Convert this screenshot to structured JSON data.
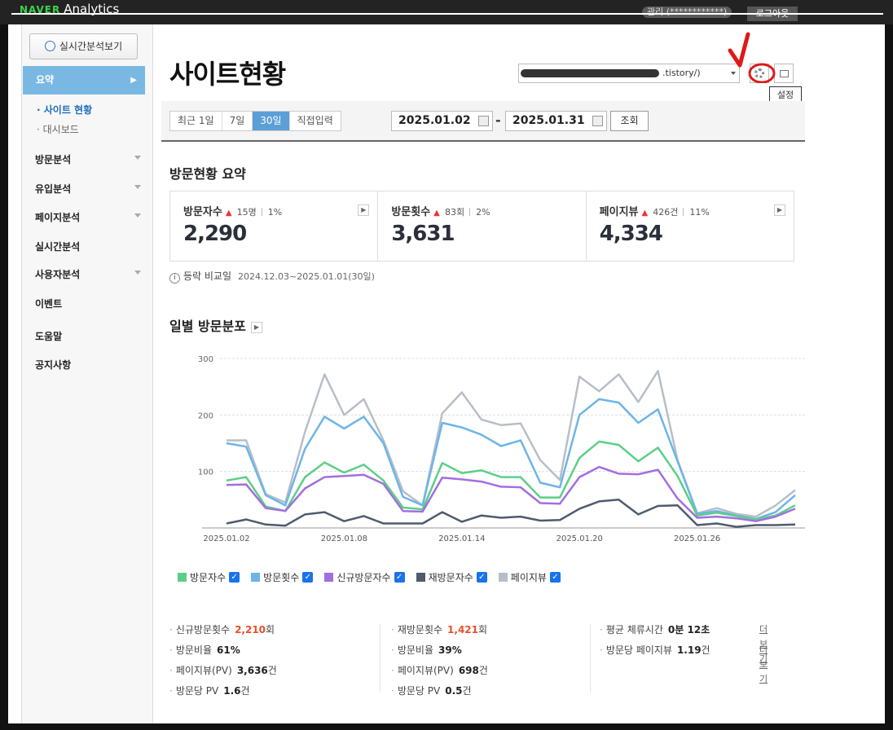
{
  "topbar": {
    "logo_brand": "NAVER",
    "logo_product": "Analytics",
    "user": "관리 (************)",
    "logout": "로그아웃"
  },
  "sidebar": {
    "realtime_button": "실시간분석보기",
    "active_menu": "요약",
    "submenu": [
      "사이트 현황",
      "대시보드"
    ],
    "items": [
      {
        "label": "방문분석",
        "has_caret": true
      },
      {
        "label": "유입분석",
        "has_caret": true
      },
      {
        "label": "페이지분석",
        "has_caret": true
      },
      {
        "label": "실시간분석",
        "has_caret": false
      },
      {
        "label": "사용자분석",
        "has_caret": true
      },
      {
        "label": "이벤트",
        "has_caret": false
      },
      {
        "label": "도움말",
        "has_caret": false
      },
      {
        "label": "공지사항",
        "has_caret": false
      }
    ]
  },
  "header": {
    "title": "사이트현황",
    "site_select_suffix": ".tistory/)",
    "tooltip": "설정"
  },
  "filter": {
    "periods": [
      "최근 1일",
      "7일",
      "30일",
      "직접입력"
    ],
    "active_period": "30일",
    "start_date": "2025.01.02",
    "end_date": "2025.01.31",
    "dash": "-",
    "query": "조회"
  },
  "summary": {
    "title": "방문현황 요약",
    "cards": [
      {
        "label": "방문자수",
        "diff": "15명",
        "pct": "1%",
        "value": "2,290"
      },
      {
        "label": "방문횟수",
        "diff": "83회",
        "pct": "2%",
        "value": "3,631"
      },
      {
        "label": "페이지뷰",
        "diff": "426건",
        "pct": "11%",
        "value": "4,334"
      }
    ],
    "compare_label": "등락 비교일",
    "compare_range": "2024.12.03~2025.01.01(30일)"
  },
  "daily": {
    "title": "일별 방문분포"
  },
  "chart_data": {
    "type": "line",
    "ylim": [
      0,
      300
    ],
    "yticks": [
      100,
      200,
      300
    ],
    "xtick_labels": [
      "2025.01.02",
      "2025.01.08",
      "2025.01.14",
      "2025.01.20",
      "2025.01.26"
    ],
    "xtick_index": [
      0,
      6,
      12,
      18,
      24
    ],
    "x": [
      "01.02",
      "01.03",
      "01.04",
      "01.05",
      "01.06",
      "01.07",
      "01.08",
      "01.09",
      "01.10",
      "01.11",
      "01.12",
      "01.13",
      "01.14",
      "01.15",
      "01.16",
      "01.17",
      "01.18",
      "01.19",
      "01.20",
      "01.21",
      "01.22",
      "01.23",
      "01.24",
      "01.25",
      "01.26",
      "01.27",
      "01.28",
      "01.29",
      "01.30",
      "01.31"
    ],
    "series": [
      {
        "name": "방문자수",
        "color": "#5ccf87",
        "values": [
          84,
          90,
          38,
          30,
          90,
          116,
          98,
          112,
          84,
          36,
          33,
          115,
          97,
          102,
          90,
          90,
          54,
          54,
          124,
          153,
          147,
          118,
          142,
          92,
          22,
          27,
          21,
          15,
          22,
          40
        ]
      },
      {
        "name": "방문횟수",
        "color": "#6cb5e8",
        "values": [
          150,
          144,
          58,
          40,
          140,
          197,
          176,
          197,
          150,
          55,
          40,
          186,
          178,
          165,
          145,
          155,
          80,
          72,
          200,
          228,
          222,
          186,
          210,
          118,
          25,
          30,
          22,
          16,
          28,
          58
        ]
      },
      {
        "name": "신규방문자수",
        "color": "#a36ee0",
        "values": [
          76,
          77,
          35,
          30,
          70,
          90,
          92,
          94,
          78,
          30,
          29,
          89,
          86,
          82,
          73,
          72,
          44,
          43,
          90,
          108,
          96,
          95,
          103,
          52,
          18,
          20,
          17,
          12,
          20,
          34
        ]
      },
      {
        "name": "재방문자수",
        "color": "#4f5b6e",
        "values": [
          8,
          15,
          6,
          4,
          24,
          28,
          12,
          21,
          8,
          8,
          8,
          28,
          11,
          22,
          18,
          20,
          13,
          14,
          34,
          47,
          50,
          24,
          39,
          40,
          5,
          8,
          2,
          5,
          5,
          6
        ]
      },
      {
        "name": "페이지뷰",
        "color": "#b8bec8",
        "values": [
          155,
          155,
          60,
          45,
          170,
          272,
          200,
          228,
          155,
          65,
          40,
          203,
          240,
          192,
          182,
          185,
          120,
          85,
          268,
          242,
          272,
          223,
          278,
          120,
          26,
          35,
          25,
          20,
          40,
          67
        ]
      }
    ]
  },
  "legend_labels": [
    "방문자수",
    "방문횟수",
    "신규방문자수",
    "재방문자수",
    "페이지뷰"
  ],
  "stats": {
    "col1": [
      {
        "label": "신규방문횟수",
        "value": "2,210",
        "unit": "회",
        "highlight": true
      },
      {
        "label": "방문비율",
        "value": "61%",
        "unit": ""
      },
      {
        "label": "페이지뷰(PV)",
        "value": "3,636",
        "unit": "건"
      },
      {
        "label": "방문당 PV",
        "value": "1.6",
        "unit": "건"
      }
    ],
    "col2": [
      {
        "label": "재방문횟수",
        "value": "1,421",
        "unit": "회",
        "highlight": true
      },
      {
        "label": "방문비율",
        "value": "39%",
        "unit": ""
      },
      {
        "label": "페이지뷰(PV)",
        "value": "698",
        "unit": "건"
      },
      {
        "label": "방문당 PV",
        "value": "0.5",
        "unit": "건"
      }
    ],
    "col3": [
      {
        "label": "평균 체류시간",
        "value": "0분 12초",
        "unit": "",
        "link": "더보기"
      },
      {
        "label": "방문당 페이지뷰",
        "value": "1.19",
        "unit": "건",
        "link": "더보기"
      }
    ]
  }
}
